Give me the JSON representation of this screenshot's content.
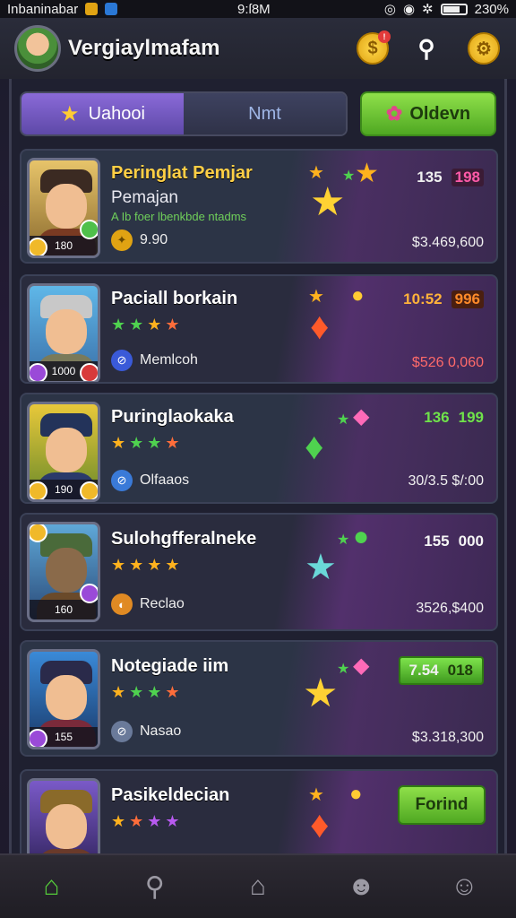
{
  "status_bar": {
    "carrier": "Inbaninabar",
    "time": "9:ſ8M",
    "battery": "230%"
  },
  "header": {
    "title": "Vergiaylmafam",
    "notification_badge": "!"
  },
  "tabs": [
    {
      "label": "Uahooi",
      "active": true
    },
    {
      "label": "Nmt",
      "active": false
    }
  ],
  "action_button": {
    "label": "Oldevn"
  },
  "cards": [
    {
      "name": "Peringlat Pemjar",
      "subtitle": "Pemajan",
      "hint": "A Ib foer lbenkbde ntadms",
      "level": "180",
      "resource": "9.90",
      "stat_a": "135",
      "stat_b": "198",
      "price": "$3.469,600"
    },
    {
      "name": "Paciall borkain",
      "level": "1000",
      "resource": "Memlcoh",
      "stat_a": "10:52",
      "stat_b": "996",
      "price": "$526 0,060"
    },
    {
      "name": "Puringlaokaka",
      "level": "190",
      "resource": "Olfaaos",
      "stat_a": "136",
      "stat_b": "199",
      "price": "30/3.5 $/:00"
    },
    {
      "name": "Sulohgfferalneke",
      "level": "160",
      "resource": "Reclao",
      "stat_a": "155",
      "stat_b": "000",
      "price": "3526,$400"
    },
    {
      "name": "Notegiade iim",
      "level": "155",
      "resource": "Nasao",
      "stat_a": "7.54",
      "stat_b": "018",
      "price": "$3.318,300"
    },
    {
      "name": "Pasikeldecian",
      "button": "Forind"
    }
  ],
  "icons": {
    "search": "search-icon",
    "gear": "gear-icon",
    "coin": "coin-icon",
    "home": "home-icon",
    "shop": "shop-icon",
    "profile": "profile-icon",
    "friends": "friends-icon"
  },
  "colors": {
    "accent_green": "#55cc3a",
    "accent_purple": "#6b52c0",
    "gold": "#ffcf45"
  }
}
